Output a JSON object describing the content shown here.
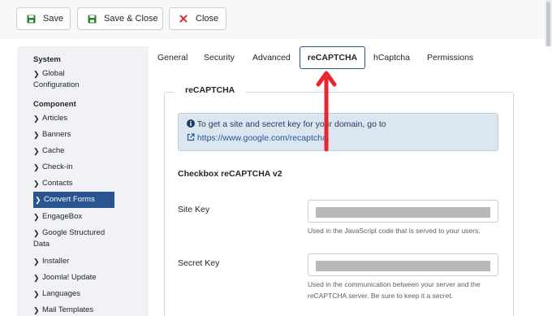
{
  "toolbar": {
    "save_label": "Save",
    "save_close_label": "Save & Close",
    "close_label": "Close"
  },
  "sidebar": {
    "system_heading": "System",
    "global_config": "Global Configuration",
    "component_heading": "Component",
    "items": [
      {
        "label": "Articles"
      },
      {
        "label": "Banners"
      },
      {
        "label": "Cache"
      },
      {
        "label": "Check-in"
      },
      {
        "label": "Contacts"
      },
      {
        "label": "Convert Forms"
      },
      {
        "label": "EngageBox"
      },
      {
        "label": "Google Structured Data"
      },
      {
        "label": "Installer"
      },
      {
        "label": "Joomla! Update"
      },
      {
        "label": "Languages"
      },
      {
        "label": "Mail Templates"
      }
    ]
  },
  "tabs": [
    {
      "label": "General"
    },
    {
      "label": "Security"
    },
    {
      "label": "Advanced"
    },
    {
      "label": "reCAPTCHA"
    },
    {
      "label": "hCaptcha"
    },
    {
      "label": "Permissions"
    }
  ],
  "panel": {
    "legend": "reCAPTCHA",
    "alert_text": "To get a site and secret key for your domain, go to",
    "alert_link": "https://www.google.com/recaptcha",
    "alert_tail": ".",
    "section_title": "Checkbox reCAPTCHA v2",
    "site_key_label": "Site Key",
    "site_key_hint": "Used in the JavaScript code that is served to your users.",
    "secret_key_label": "Secret Key",
    "secret_key_hint": "Used in the communication between your server and the reCAPTCHA server. Be sure to keep it a secret."
  },
  "colors": {
    "accent": "#2a5490",
    "annotation_arrow": "#e8262d",
    "alert_bg": "#dbe6f1"
  }
}
